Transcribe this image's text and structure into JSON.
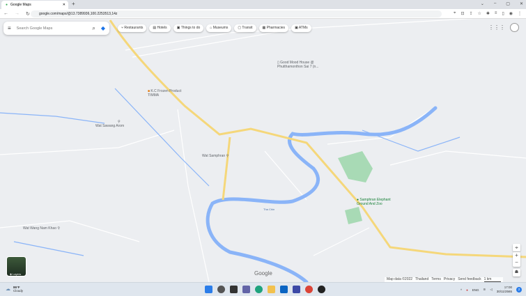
{
  "browser": {
    "tab_title": "Google Maps",
    "url": "google.com/maps/@13.7389936,100.2253513,14z"
  },
  "search": {
    "placeholder": "Search Google Maps"
  },
  "chips": [
    "Restaurants",
    "Hotels",
    "Things to do",
    "Museums",
    "Transit",
    "Pharmacies",
    "ATMs"
  ],
  "chip_icons": [
    "⑂",
    "▤",
    "▣",
    "⌂",
    "▢",
    "▦",
    "▣"
  ],
  "places": {
    "good_mood": "Good Mood House @ Phutthamonthon Sai 7 (n...",
    "kc_frozen": "K.C Frozen Product TIMMA",
    "wat_sawang": "Wat Sawang Arom",
    "wat_samphran": "Wat Samphran",
    "elephant": "Samphran Elephant Ground And Zoo",
    "wat_wang": "Wat Wang Nam Khao",
    "river": "Tha Chin"
  },
  "layers_label": "Layers",
  "google_logo": "Google",
  "attribution": [
    "Map data ©2022",
    "Thailand",
    "Terms",
    "Privacy",
    "Send feedback",
    "1 km"
  ],
  "weather": {
    "temp": "86°F",
    "cond": "Cloudy"
  },
  "tray": {
    "lang": "ENG",
    "time": "17:00",
    "date": "30/11/2565",
    "notif": "2"
  },
  "colors": {
    "highway": "#f5d77a",
    "river": "#8ab4f8",
    "park": "#a8dab5"
  }
}
